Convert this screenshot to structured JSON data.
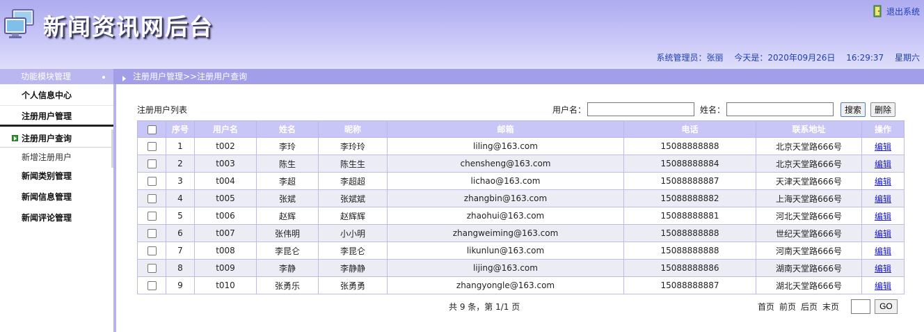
{
  "header": {
    "title": "新闻资讯网后台",
    "logout_label": "退出系统",
    "admin_label": "系统管理员：张丽",
    "date_label": "今天是：2020年09月26日",
    "time": "16:29:37",
    "weekday": "星期六",
    "logo_icon": "computer-monitors-icon",
    "logout_icon": "exit-door-icon"
  },
  "subbar": {
    "module_title": "功能模块管理",
    "breadcrumb": "注册用户管理>>注册用户查询"
  },
  "sidebar": {
    "items": [
      {
        "label": "个人信息中心"
      },
      {
        "label": "注册用户管理"
      },
      {
        "label": "新闻类别管理"
      },
      {
        "label": "新闻信息管理"
      },
      {
        "label": "新闻评论管理"
      }
    ],
    "submenu": {
      "active_label": "注册用户查询",
      "add_label": "新增注册用户"
    }
  },
  "main": {
    "list_title": "注册用户列表",
    "search": {
      "username_label": "用户名：",
      "username_value": "",
      "realname_label": "姓名：",
      "realname_value": "",
      "search_button": "搜索",
      "delete_button": "删除"
    },
    "table": {
      "columns": [
        "序号",
        "用户名",
        "姓名",
        "昵称",
        "邮箱",
        "电话",
        "联系地址",
        "操作"
      ],
      "edit_label": "编辑",
      "rows": [
        [
          "1",
          "t002",
          "李玲",
          "李玲玲",
          "liling@163.com",
          "15088888888",
          "北京天堂路666号"
        ],
        [
          "2",
          "t003",
          "陈生",
          "陈生生",
          "chensheng@163.com",
          "15088888884",
          "北京天堂路666号"
        ],
        [
          "3",
          "t004",
          "李超",
          "李超超",
          "lichao@163.com",
          "15088888887",
          "天津天堂路666号"
        ],
        [
          "4",
          "t005",
          "张斌",
          "张斌斌",
          "zhangbin@163.com",
          "15088888882",
          "上海天堂路666号"
        ],
        [
          "5",
          "t006",
          "赵辉",
          "赵辉辉",
          "zhaohui@163.com",
          "15088888881",
          "河北天堂路666号"
        ],
        [
          "6",
          "t007",
          "张伟明",
          "小小明",
          "zhangweiming@163.com",
          "15088888888",
          "世纪天堂路666号"
        ],
        [
          "7",
          "t008",
          "李昆仑",
          "李昆仑",
          "likunlun@163.com",
          "15088888888",
          "河南天堂路666号"
        ],
        [
          "8",
          "t009",
          "李静",
          "李静静",
          "lijing@163.com",
          "15088888886",
          "湖南天堂路666号"
        ],
        [
          "9",
          "t010",
          "张勇乐",
          "张勇勇",
          "zhangyongle@163.com",
          "15088888887",
          "湖北天堂路666号"
        ]
      ]
    },
    "pagination": {
      "summary": "共 9 条，第 1/1 页",
      "first": "首页",
      "prev": "前页",
      "next": "后页",
      "last": "末页",
      "page_input": "",
      "go_button": "GO"
    }
  },
  "colors": {
    "header_top": "#aeabef",
    "subbar": "#a29fe8",
    "table_header": "#c8c6f6",
    "link": "#1b3fb5"
  }
}
